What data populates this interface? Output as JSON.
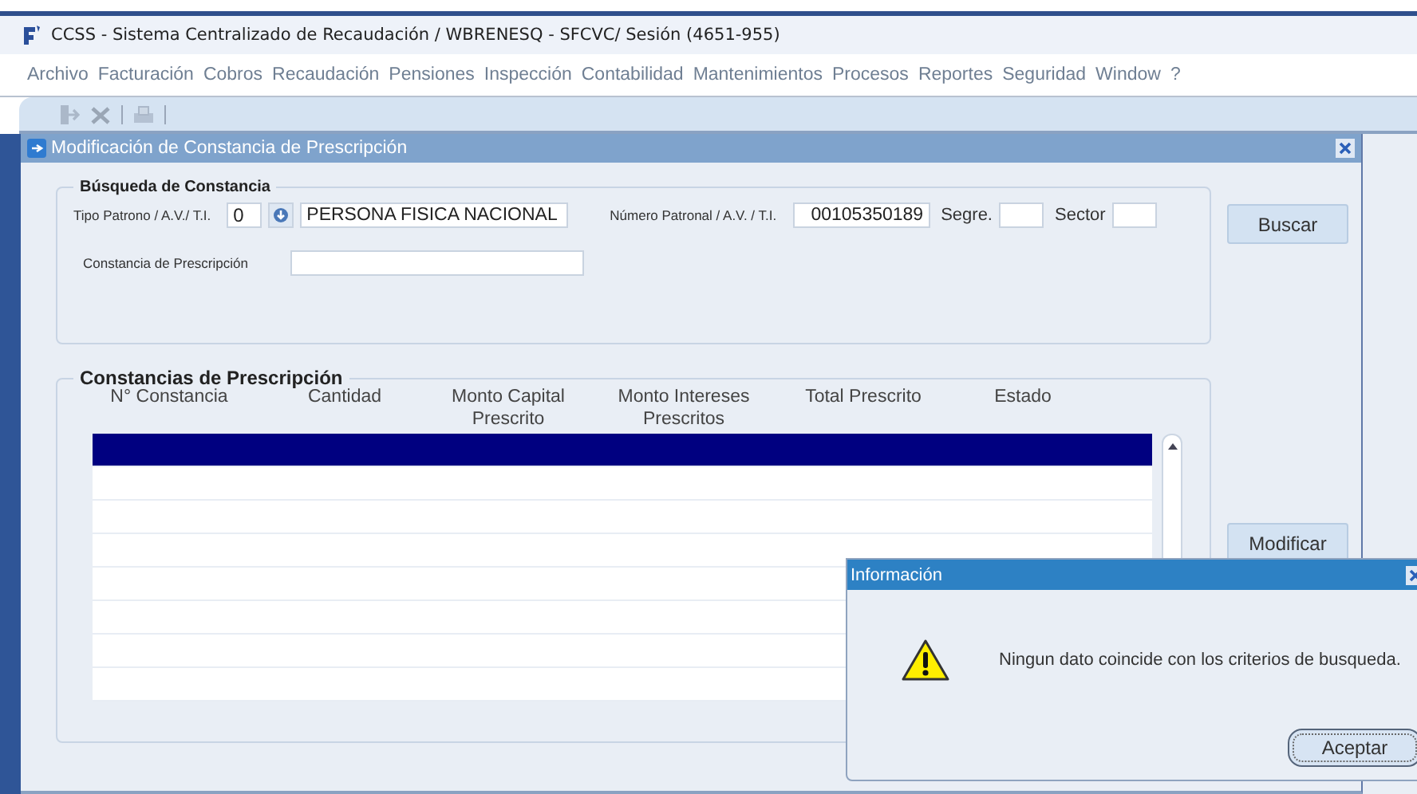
{
  "window": {
    "title": "CCSS - Sistema Centralizado de Recaudación / WBRENESQ - SFCVC/ Sesión (4651-955)"
  },
  "menu": [
    "Archivo",
    "Facturación",
    "Cobros",
    "Recaudación",
    "Pensiones",
    "Inspección",
    "Contabilidad",
    "Mantenimientos",
    "Procesos",
    "Reportes",
    "Seguridad",
    "Window",
    "?"
  ],
  "toolbar": [
    {
      "kind": "exit",
      "disabled": true
    },
    {
      "kind": "delete",
      "disabled": true
    },
    {
      "kind": "separator"
    },
    {
      "kind": "print",
      "disabled": true
    },
    {
      "kind": "separator"
    }
  ],
  "form": {
    "title": "Modificación de Constancia de Prescripción",
    "search_group": {
      "title": "Búsqueda de Constancia",
      "tipo_label": "Tipo Patrono / A.V./ T.I.",
      "tipo_code": "0",
      "tipo_name": "PERSONA FISICA NACIONAL",
      "numero_label": "Número Patronal / A.V. / T.I.",
      "numero": "00105350189",
      "segre_label": "Segre.",
      "sector_label": "Sector",
      "constancia_label": "Constancia de Prescripción"
    },
    "search_button": "Buscar",
    "table": {
      "title": "Constancias de Prescripción",
      "columns": [
        {
          "label": "N° Constancia"
        },
        {
          "label": "Cantidad"
        },
        {
          "label": "Monto Capital Prescrito"
        },
        {
          "label": "Monto Intereses Prescritos"
        },
        {
          "label": "Total Prescrito"
        },
        {
          "label": "Estado"
        }
      ],
      "rows": [
        {
          "selected": true
        },
        {
          "selected": false
        },
        {
          "selected": false
        },
        {
          "selected": false
        },
        {
          "selected": false
        },
        {
          "selected": false
        },
        {
          "selected": false
        },
        {
          "selected": false
        }
      ]
    },
    "modify_button": "Modificar"
  },
  "dialog": {
    "title": "Información",
    "message": "Ningun dato coincide con los criterios de busqueda.",
    "button": "Aceptar"
  }
}
